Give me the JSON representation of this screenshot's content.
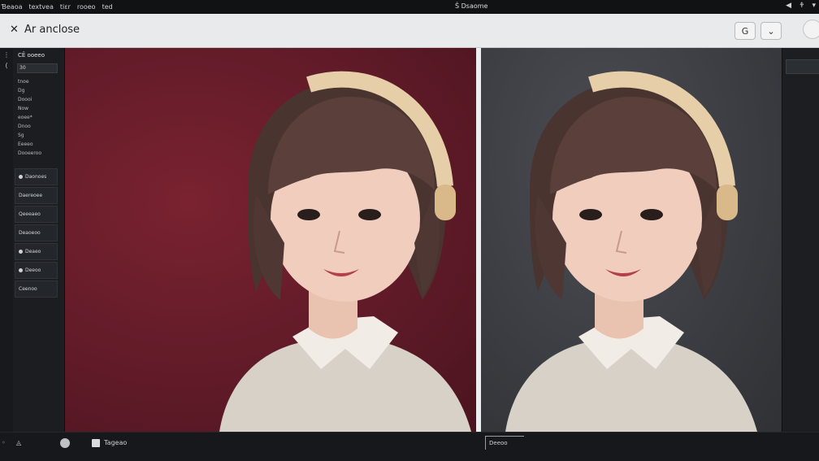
{
  "menubar": {
    "menus": [
      "Ɓeaoa",
      "textvea",
      "tiɛr",
      "rooeo",
      "ted"
    ],
    "app_title": "Ŝ Dsaome",
    "tray": [
      "◀",
      "🕈",
      "▾"
    ]
  },
  "titlebar": {
    "close_glyph": "✕",
    "title": "Ar anclose",
    "buttons": [
      "G",
      "⌄"
    ]
  },
  "rail": [
    "⋮",
    "("
  ],
  "left_panel": {
    "header": "CẼ ooeeo",
    "field_value": "30",
    "list": [
      "tnoe",
      "Dg",
      "Doooi",
      "Now",
      "eoee*",
      "Dnoo",
      "Sg",
      "Eeeeo",
      "Dooeeroo"
    ],
    "buttons": [
      "Daonoes",
      "Daereoee",
      "Qeeeaeo",
      "Deaoeoo",
      "Deaeo",
      "Deeoo",
      "Ceenoo"
    ]
  },
  "statusbar": {
    "items": [
      "◦",
      "◬"
    ],
    "label": "Tageao",
    "field": "Deeoo"
  },
  "colors": {
    "left_bg": "#5e1a27",
    "right_bg": "#3a3c41",
    "ui_dark": "#1b1d21",
    "titlebar": "#e9eaeb"
  },
  "icons": {
    "close": "close-icon",
    "tb_button_1": "grab-icon",
    "tb_button_2": "dropdown-icon",
    "avatar": "avatar-icon"
  }
}
